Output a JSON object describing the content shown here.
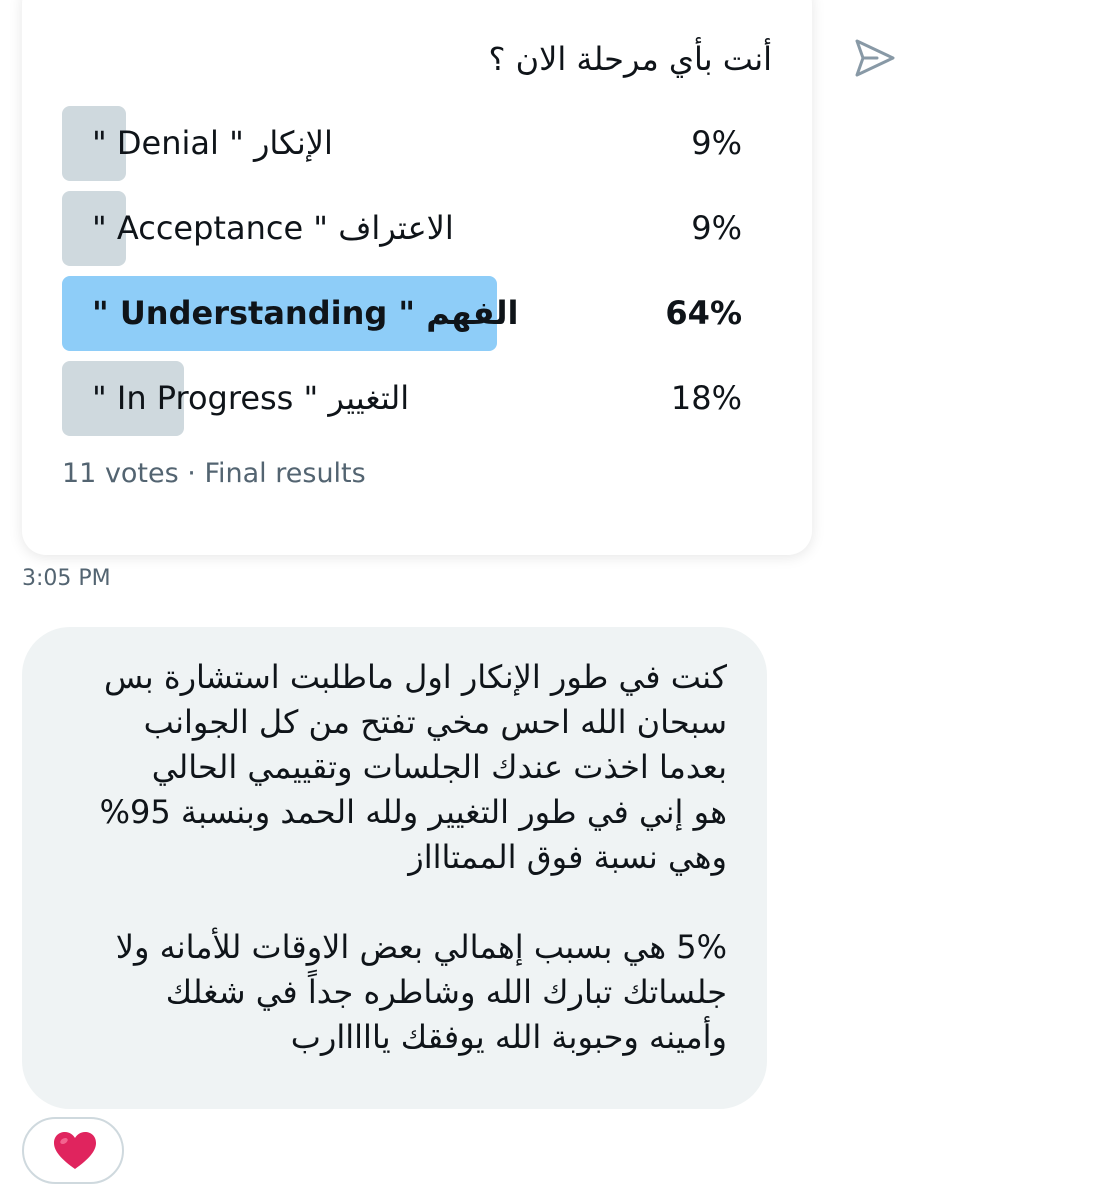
{
  "poll": {
    "question": "أنت بأي مرحلة الان ؟",
    "options": [
      {
        "label": "الإنكار \" Denial \"",
        "percent_text": "9%",
        "percent": 9
      },
      {
        "label": "الاعتراف \" Acceptance \"",
        "percent_text": "9%",
        "percent": 9
      },
      {
        "label": "الفهم \" Understanding \"",
        "percent_text": "64%",
        "percent": 64,
        "winner": true
      },
      {
        "label": "التغيير \" In Progress \"",
        "percent_text": "18%",
        "percent": 18
      }
    ],
    "meta": "11 votes · Final results"
  },
  "icons": {
    "share": "share-arrow-icon",
    "reaction": "heart-icon"
  },
  "timestamp": "3:05 PM",
  "message": {
    "lines": [
      "كنت في طور الإنكار اول ماطلبت استشارة بس",
      "سبحان الله احس مخي تفتح من كل الجوانب",
      "بعدما اخذت عندك الجلسات وتقييمي الحالي",
      "هو إني في طور التغيير ولله الحمد وبنسبة 95%",
      "وهي نسبة فوق الممتاااز",
      "",
      "5% هي بسبب إهمالي بعض الاوقات للأمانه ولا",
      "جلساتك تبارك الله وشاطره جداً في شغلك",
      "وأمينه وحبوبة الله يوفقك يااااارب"
    ]
  },
  "reaction": {
    "emoji": "heart",
    "color": "#e0245e"
  },
  "colors": {
    "bar": "#cfd9de",
    "bar_winner": "#8ecdf8",
    "bubble": "#eff3f4",
    "muted": "#536471"
  }
}
